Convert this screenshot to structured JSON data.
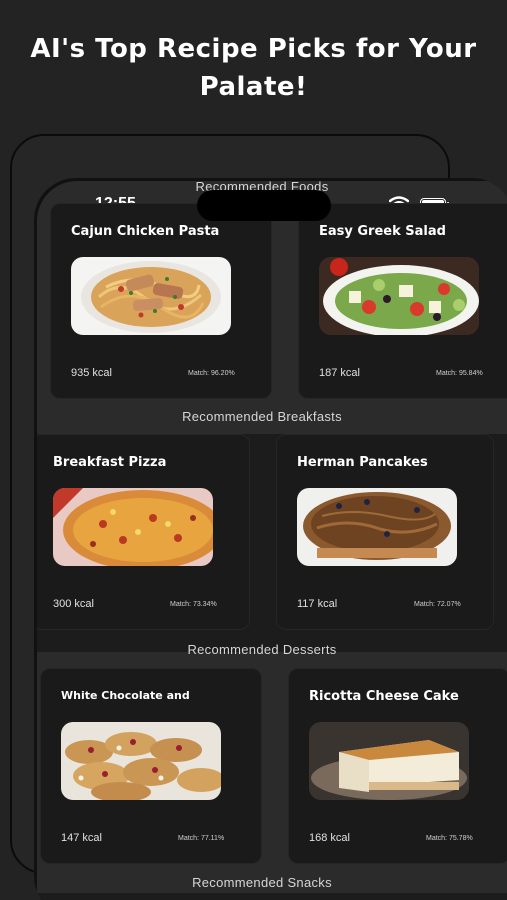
{
  "headline": {
    "line1": "AI's Top Recipe Picks for Your",
    "line2": "Palate!"
  },
  "status_bar": {
    "time": "12:55"
  },
  "sections": {
    "foods": "Recommended Foods",
    "breakfasts": "Recommended Breakfasts",
    "desserts": "Recommended Desserts",
    "snacks": "Recommended Snacks"
  },
  "cards": {
    "foods": [
      {
        "title": "Cajun Chicken Pasta",
        "kcal": "935 kcal",
        "match": "Match: 96.20%",
        "image": "pasta-photo"
      },
      {
        "title": "Easy Greek Salad",
        "kcal": "187 kcal",
        "match": "Match: 95.84%",
        "image": "salad-photo"
      }
    ],
    "breakfasts": [
      {
        "title": "Breakfast Pizza",
        "kcal": "300 kcal",
        "match": "Match: 73.34%",
        "image": "pizza-photo"
      },
      {
        "title": "Herman Pancakes",
        "kcal": "117 kcal",
        "match": "Match: 72.07%",
        "image": "pancake-photo"
      }
    ],
    "desserts": [
      {
        "title": "White Chocolate and",
        "kcal": "147 kcal",
        "match": "Match: 77.11%",
        "image": "cookies-photo"
      },
      {
        "title": "Ricotta Cheese Cake",
        "kcal": "168 kcal",
        "match": "Match: 75.78%",
        "image": "cheesecake-photo"
      }
    ]
  },
  "colors": {
    "background": "#232323",
    "card": "#1a1a1a",
    "band": "#1c1c1c",
    "screen": "#2b2b2b",
    "text": "#ffffff"
  }
}
